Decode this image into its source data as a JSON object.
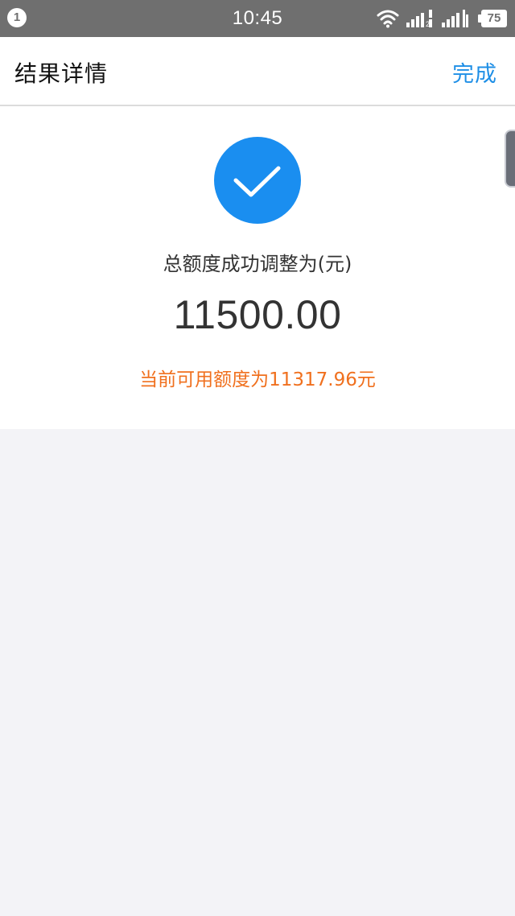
{
  "status_bar": {
    "notification_count": "1",
    "time": "10:45",
    "battery_level": "75",
    "sim2_label": "2",
    "icons": [
      "wifi-icon",
      "signal-icon",
      "signal-icon",
      "battery-icon"
    ]
  },
  "header": {
    "title": "结果详情",
    "done_label": "完成"
  },
  "result": {
    "icon": "check-icon",
    "label": "总额度成功调整为(元)",
    "amount": "11500.00",
    "available_note": "当前可用额度为11317.96元"
  },
  "colors": {
    "accent": "#1f8fe6",
    "success_icon": "#1a8ef0",
    "warning_text": "#f0701e",
    "status_bar": "#6f6f6f",
    "page_background": "#f3f3f7"
  }
}
